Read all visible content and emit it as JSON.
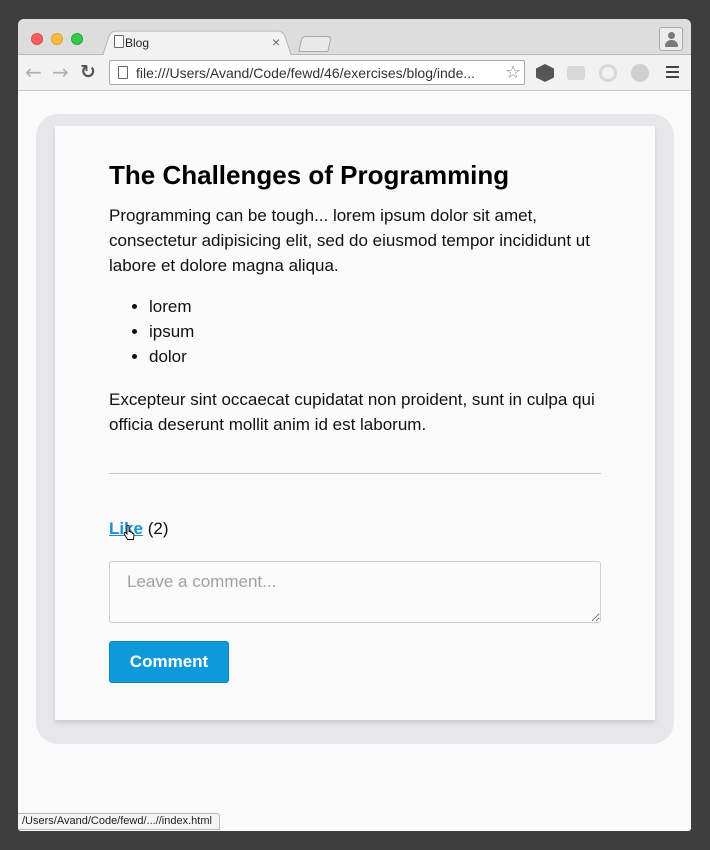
{
  "browser": {
    "tab_title": "Blog",
    "tab_close": "×",
    "url": "file:///Users/Avand/Code/fewd/46/exercises/blog/inde...",
    "back_glyph": "←",
    "forward_glyph": "→",
    "reload_glyph": "↻",
    "star_glyph": "☆",
    "status_url": "/Users/Avand/Code/fewd/...//index.html"
  },
  "article": {
    "title": "The Challenges of Programming",
    "intro": "Programming can be tough... lorem ipsum dolor sit amet, consectetur adipisicing elit, sed do eiusmod tempor incididunt ut labore et dolore magna aliqua.",
    "list_items": [
      "lorem",
      "ipsum",
      "dolor"
    ],
    "outro": "Excepteur sint occaecat cupidatat non proident, sunt in culpa qui officia deserunt mollit anim id est laborum."
  },
  "feedback": {
    "like_label": "Like",
    "like_count": "(2)",
    "comment_placeholder": "Leave a comment...",
    "comment_button": "Comment"
  },
  "colors": {
    "accent": "#0e9ad8",
    "link": "#1b8fd0",
    "close_light": "#fc605c",
    "minimize_light": "#fdbc40",
    "zoom_light": "#34c84a"
  },
  "icons": [
    "page-icon",
    "close-icon",
    "profile-icon",
    "back-arrow-icon",
    "forward-arrow-icon",
    "reload-icon",
    "bookmark-star-icon",
    "extension-icon",
    "menu-icon",
    "hand-cursor-icon"
  ]
}
